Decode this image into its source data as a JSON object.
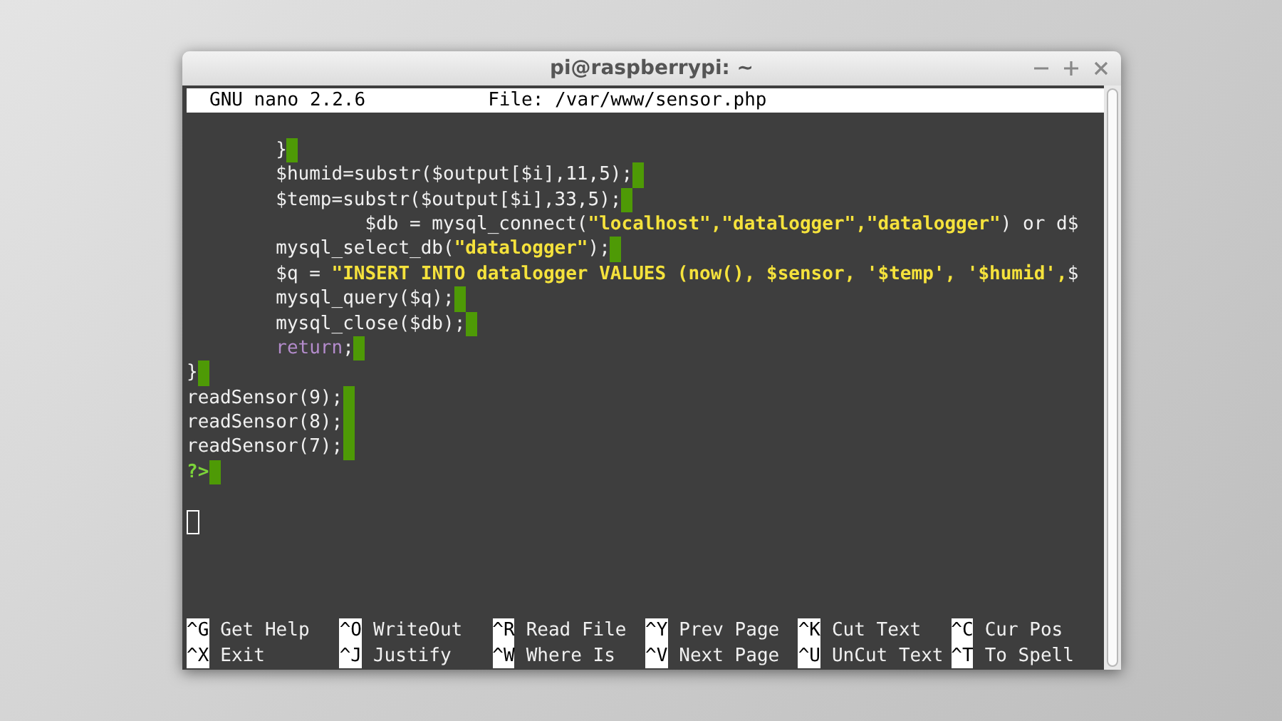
{
  "window": {
    "title": "pi@raspberrypi: ~"
  },
  "nano_header": {
    "version": "GNU nano 2.2.6",
    "file": "File: /var/www/sensor.php"
  },
  "lines": [
    {
      "kind": "blank"
    },
    {
      "marker": true,
      "segments": [
        {
          "kind": "plain",
          "text": "        }"
        }
      ]
    },
    {
      "marker": true,
      "segments": [
        {
          "kind": "plain",
          "text": "        $humid=substr($output[$i],11,5);"
        }
      ]
    },
    {
      "marker": true,
      "segments": [
        {
          "kind": "plain",
          "text": "        $temp=substr($output[$i],33,5);"
        }
      ]
    },
    {
      "marker": false,
      "segments": [
        {
          "kind": "plain",
          "text": "                $db = mysql_connect("
        },
        {
          "kind": "string",
          "text": "\"localhost\",\"datalogger\",\"datalogger\""
        },
        {
          "kind": "plain",
          "text": ") or d$"
        }
      ]
    },
    {
      "marker": true,
      "segments": [
        {
          "kind": "plain",
          "text": "        mysql_select_db("
        },
        {
          "kind": "string",
          "text": "\"datalogger\""
        },
        {
          "kind": "plain",
          "text": ");"
        }
      ]
    },
    {
      "marker": false,
      "segments": [
        {
          "kind": "plain",
          "text": "        $q = "
        },
        {
          "kind": "string",
          "text": "\"INSERT INTO datalogger VALUES (now(), $sensor, '$temp', '$humid',"
        },
        {
          "kind": "plain",
          "text": "$"
        }
      ]
    },
    {
      "marker": true,
      "segments": [
        {
          "kind": "plain",
          "text": "        mysql_query($q);"
        }
      ]
    },
    {
      "marker": true,
      "segments": [
        {
          "kind": "plain",
          "text": "        mysql_close($db);"
        }
      ]
    },
    {
      "marker": true,
      "segments": [
        {
          "kind": "keyword",
          "text": "        return"
        },
        {
          "kind": "plain",
          "text": ";"
        }
      ]
    },
    {
      "marker": true,
      "segments": [
        {
          "kind": "plain",
          "text": "}"
        }
      ]
    },
    {
      "marker": true,
      "segments": [
        {
          "kind": "plain",
          "text": "readSensor(9);"
        }
      ]
    },
    {
      "marker": true,
      "segments": [
        {
          "kind": "plain",
          "text": "readSensor(8);"
        }
      ]
    },
    {
      "marker": true,
      "segments": [
        {
          "kind": "plain",
          "text": "readSensor(7);"
        }
      ]
    },
    {
      "marker": true,
      "segments": [
        {
          "kind": "tag",
          "text": "?>"
        }
      ]
    },
    {
      "kind": "blank"
    },
    {
      "kind": "cursor",
      "cursor": true
    }
  ],
  "shortcuts": [
    [
      {
        "key": "^G",
        "label": "Get Help"
      },
      {
        "key": "^O",
        "label": "WriteOut"
      },
      {
        "key": "^R",
        "label": "Read File"
      },
      {
        "key": "^Y",
        "label": "Prev Page"
      },
      {
        "key": "^K",
        "label": "Cut Text"
      },
      {
        "key": "^C",
        "label": "Cur Pos"
      }
    ],
    [
      {
        "key": "^X",
        "label": "Exit"
      },
      {
        "key": "^J",
        "label": "Justify"
      },
      {
        "key": "^W",
        "label": "Where Is"
      },
      {
        "key": "^V",
        "label": "Next Page"
      },
      {
        "key": "^U",
        "label": "UnCut Text"
      },
      {
        "key": "^T",
        "label": "To Spell"
      }
    ]
  ]
}
